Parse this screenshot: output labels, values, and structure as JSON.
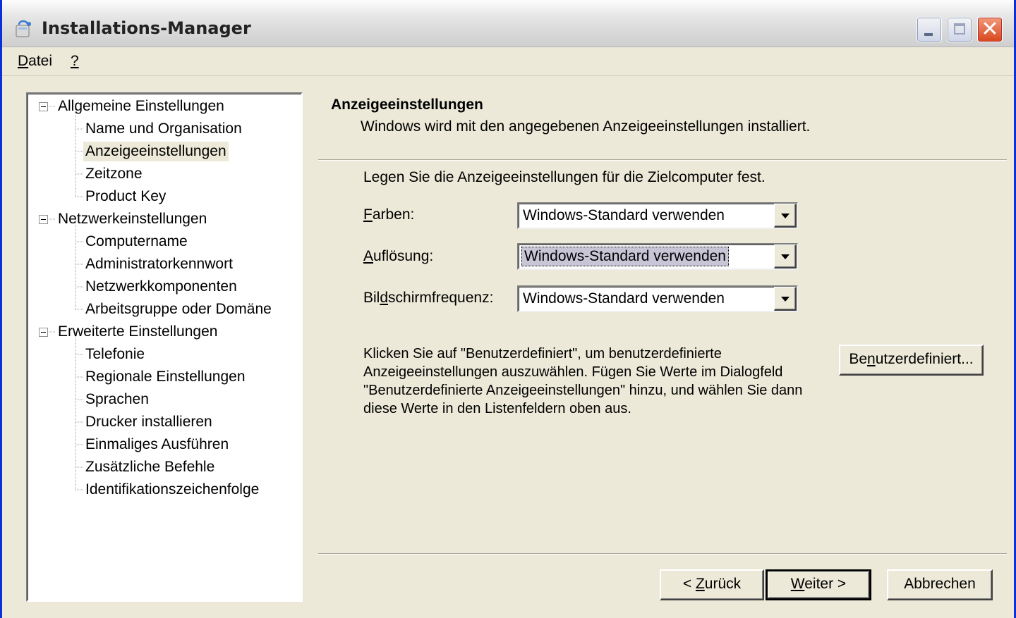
{
  "window": {
    "title": "Installations-Manager",
    "icon": "installer-icon",
    "controls": [
      "minimize-icon",
      "maximize-icon",
      "close-icon"
    ]
  },
  "menu": {
    "items": [
      {
        "label": "Datei",
        "mnemonic": "D"
      },
      {
        "label": "?",
        "mnemonic": "?"
      }
    ]
  },
  "tree": {
    "groups": [
      {
        "label": "Allgemeine Einstellungen",
        "children": [
          "Name und Organisation",
          "Anzeigeeinstellungen",
          "Zeitzone",
          "Product Key"
        ]
      },
      {
        "label": "Netzwerkeinstellungen",
        "children": [
          "Computername",
          "Administratorkennwort",
          "Netzwerkkomponenten",
          "Arbeitsgruppe oder Domäne"
        ]
      },
      {
        "label": "Erweiterte Einstellungen",
        "children": [
          "Telefonie",
          "Regionale Einstellungen",
          "Sprachen",
          "Drucker installieren",
          "Einmaliges Ausführen",
          "Zusätzliche Befehle",
          "Identifikationszeichenfolge"
        ]
      }
    ],
    "selected": "Anzeigeeinstellungen"
  },
  "header": {
    "title": "Anzeigeeinstellungen",
    "subtitle": "Windows wird mit den angegebenen Anzeigeeinstellungen installiert."
  },
  "content": {
    "intro": "Legen Sie die Anzeigeeinstellungen für die Zielcomputer fest.",
    "fields": [
      {
        "label_pre": "",
        "label_key": "F",
        "label_post": "arben:",
        "value": "Windows-Standard verwenden"
      },
      {
        "label_pre": "",
        "label_key": "A",
        "label_post": "uflösung:",
        "value": "Windows-Standard verwenden"
      },
      {
        "label_pre": "Bil",
        "label_key": "d",
        "label_post": "schirmfrequenz:",
        "value": "Windows-Standard verwenden"
      }
    ],
    "info": "Klicken Sie auf \"Benutzerdefiniert\", um benutzerdefinierte Anzeigeeinstellungen auszuwählen. Fügen Sie Werte im Dialogfeld \"Benutzerdefinierte Anzeigeeinstellungen\" hinzu, und wählen Sie dann diese Werte in den Listenfeldern oben aus.",
    "custom_button": {
      "pre": "Be",
      "key": "n",
      "post": "utzerdefiniert..."
    }
  },
  "footer": {
    "back": {
      "pre": "< ",
      "key": "Z",
      "post": "urück"
    },
    "next": {
      "pre": "",
      "key": "W",
      "post": "eiter >"
    },
    "cancel": "Abbrechen"
  }
}
